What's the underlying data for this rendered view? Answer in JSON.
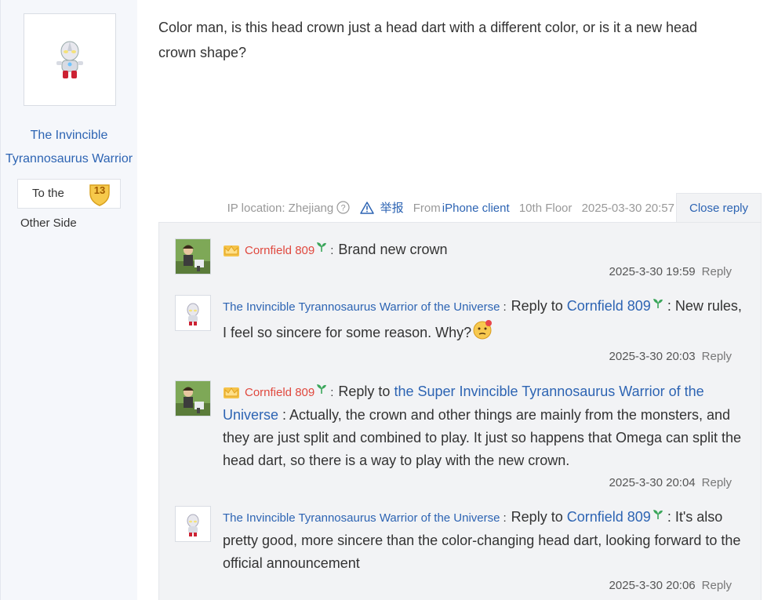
{
  "sidebar": {
    "username": "The Invincible Tyrannosaurus Warrior",
    "level_text": "To the",
    "level_number": "13",
    "level_sub": "Other Side"
  },
  "post": {
    "text": "Color man, is this head crown just a head dart with a different color, or is it a new head crown shape?"
  },
  "meta": {
    "ip_location": "IP location: Zhejiang",
    "report": "举报",
    "from_label": "From",
    "client": "iPhone client",
    "floor": "10th Floor",
    "datetime": "2025-03-30 20:57",
    "close_reply": "Close reply"
  },
  "replies": [
    {
      "author": "Cornfield 809",
      "colon": ":",
      "text": "Brand new crown",
      "time": "2025-3-30 19:59",
      "reply_label": "Reply"
    },
    {
      "author": "The Invincible Tyrannosaurus Warrior of the Universe",
      "colon": ":",
      "reply_to": "Reply to",
      "target": "Cornfield 809",
      "text": ": New rules, I feel so sincere for some reason. Why?",
      "time": "2025-3-30 20:03",
      "reply_label": "Reply"
    },
    {
      "author": "Cornfield 809",
      "colon": ":",
      "reply_to": "Reply to",
      "target": "the Super Invincible Tyrannosaurus Warrior of the Universe",
      "text": " : Actually, the crown and other things are mainly from the monsters, and they are just split and combined to play. It just so happens that Omega can split the head dart, so there is a way to play with the new crown.",
      "time": "2025-3-30 20:04",
      "reply_label": "Reply"
    },
    {
      "author": "The Invincible Tyrannosaurus Warrior of the Universe",
      "colon": ":",
      "reply_to": "Reply to",
      "target": "Cornfield 809",
      "text": ": It's also pretty good, more sincere than the color-changing head dart, looking forward to the official announcement",
      "time": "2025-3-30 20:06",
      "reply_label": "Reply"
    }
  ],
  "colors": {
    "link_blue": "#2d64b3",
    "vip_red": "#e0483e",
    "panel_bg": "#f2f3f5",
    "sidebar_bg": "#f5f7fb"
  }
}
